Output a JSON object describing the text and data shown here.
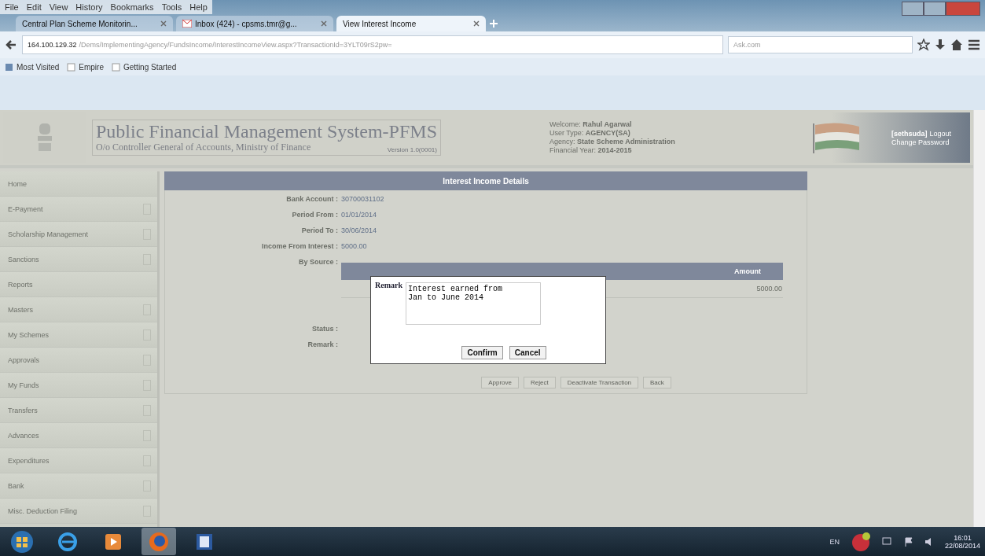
{
  "browser": {
    "menu": [
      "File",
      "Edit",
      "View",
      "History",
      "Bookmarks",
      "Tools",
      "Help"
    ],
    "tabs": [
      {
        "title": "Central Plan Scheme Monitorin...",
        "kind": "page",
        "selected": false
      },
      {
        "title": "Inbox (424) - cpsms.tmr@g...",
        "kind": "mail",
        "selected": false
      },
      {
        "title": "View Interest Income",
        "kind": "page",
        "selected": true
      }
    ],
    "url_host": "164.100.129.32",
    "url_path": "/Dems/ImplementingAgency/FundsIncome/InterestIncomeView.aspx?TransactionId=3YLT09rS2pw=",
    "search": {
      "placeholder": "Ask.com"
    },
    "bookmarks": [
      {
        "label": "Most Visited",
        "kind": "star"
      },
      {
        "label": "Empire",
        "kind": "page"
      },
      {
        "label": "Getting Started",
        "kind": "page"
      }
    ]
  },
  "header": {
    "title": "Public Financial Management System-PFMS",
    "subtitle": "O/o Controller General of Accounts, Ministry of Finance",
    "version": "Version 1.0(0001)",
    "user_info": [
      {
        "label": "Welcome:",
        "value": "Rahul Agarwal"
      },
      {
        "label": "User Type:",
        "value": "AGENCY(SA)"
      },
      {
        "label": "Agency:",
        "value": "State Scheme Administration"
      },
      {
        "label": "Financial Year:",
        "value": "2014-2015"
      }
    ],
    "account_links": [
      "[sethsuda]",
      "Logout",
      "Change Password"
    ]
  },
  "sidebar": {
    "items": [
      {
        "label": "Home",
        "expandable": false
      },
      {
        "label": "E-Payment",
        "expandable": true
      },
      {
        "label": "Scholarship Management",
        "expandable": true
      },
      {
        "label": "Sanctions",
        "expandable": true
      },
      {
        "label": "Reports",
        "expandable": false
      },
      {
        "label": "Masters",
        "expandable": true
      },
      {
        "label": "My Schemes",
        "expandable": true
      },
      {
        "label": "Approvals",
        "expandable": true
      },
      {
        "label": "My Funds",
        "expandable": true
      },
      {
        "label": "Transfers",
        "expandable": true
      },
      {
        "label": "Advances",
        "expandable": true
      },
      {
        "label": "Expenditures",
        "expandable": true
      },
      {
        "label": "Bank",
        "expandable": true
      },
      {
        "label": "Misc. Deduction Filing",
        "expandable": true
      }
    ]
  },
  "panel": {
    "title": "Interest Income Details",
    "fields": [
      {
        "label": "Bank Account :",
        "value": "30700031102"
      },
      {
        "label": "Period From :",
        "value": "01/01/2014"
      },
      {
        "label": "Period To :",
        "value": "30/06/2014"
      },
      {
        "label": "Income From Interest :",
        "value": "5000.00"
      }
    ],
    "source_label": "By Source :",
    "source_columns": [
      "Amount"
    ],
    "source_rows": [
      [
        "5000.00"
      ]
    ],
    "status_label": "Status :",
    "remark_label": "Remark :",
    "buttons": [
      "Approve",
      "Reject",
      "Deactivate Transaction",
      "Back"
    ]
  },
  "dialog": {
    "label": "Remark",
    "text": "Interest earned from\nJan to June 2014",
    "buttons": [
      "Confirm",
      "Cancel"
    ]
  },
  "taskbar": {
    "apps": [
      {
        "kind": "start",
        "active": false
      },
      {
        "kind": "ie",
        "active": false
      },
      {
        "kind": "media",
        "active": false
      },
      {
        "kind": "firefox",
        "active": true
      },
      {
        "kind": "word",
        "active": false
      }
    ],
    "language": "EN",
    "time": "16:01",
    "date": "22/08/2014"
  }
}
